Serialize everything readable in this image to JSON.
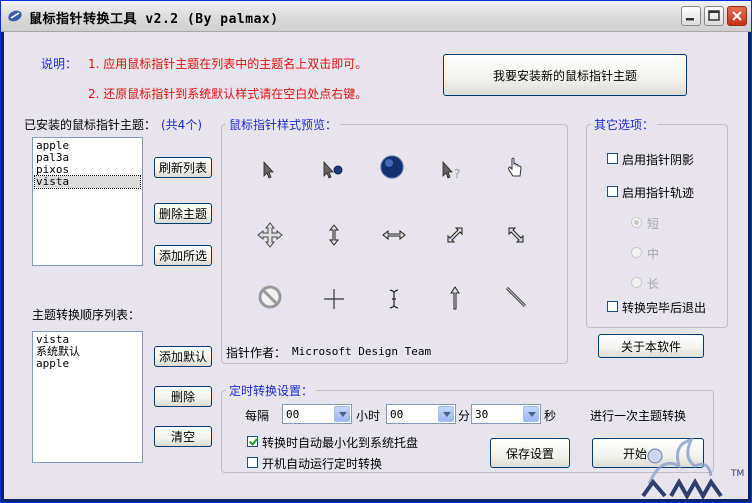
{
  "window": {
    "title": "鼠标指针转换工具 v2.2 (By palmax)"
  },
  "description": {
    "label": "说明：",
    "line1": "1. 应用鼠标指针主题在列表中的主题名上双击即可。",
    "line2": "2. 还原鼠标指针到系统默认样式请在空白处点右键。"
  },
  "install_button": "我要安装新的鼠标指针主题",
  "installed": {
    "label": "已安装的鼠标指针主题：",
    "count": "(共4个)",
    "items": [
      "apple",
      "pal3a",
      "pixos",
      "vista"
    ],
    "selected": "vista",
    "refresh_button": "刷新列表",
    "delete_button": "删除主题",
    "add_selected_button": "添加所选"
  },
  "order": {
    "label": "主题转换顺序列表：",
    "items": [
      "vista",
      "系统默认",
      "apple"
    ],
    "add_default_button": "添加默认",
    "delete_button": "删除",
    "clear_button": "清空"
  },
  "preview": {
    "label": "鼠标指针样式预览：",
    "author_label": "指针作者：",
    "author": "Microsoft Design Team"
  },
  "options": {
    "label": "其它选项：",
    "shadow": "启用指针阴影",
    "trail": "启用指针轨迹",
    "trail_short": "短",
    "trail_mid": "中",
    "trail_long": "长",
    "exit_after": "转换完毕后退出",
    "about_button": "关于本软件"
  },
  "timer": {
    "label": "定时转换设置：",
    "every": "每隔",
    "hours_value": "00",
    "hours_unit": "小时",
    "minutes_value": "00",
    "minutes_unit": "分",
    "seconds_value": "30",
    "seconds_unit": "秒",
    "suffix": "进行一次主题转换",
    "minimize_to_tray": "转换时自动最小化到系统托盘",
    "run_at_startup": "开机自动运行定时转换",
    "save_button": "保存设置",
    "start_button": "开始"
  },
  "colors": {
    "accent_blue": "#1d2bd8",
    "accent_red": "#e01010",
    "window_bg": "#e8e4ed"
  }
}
